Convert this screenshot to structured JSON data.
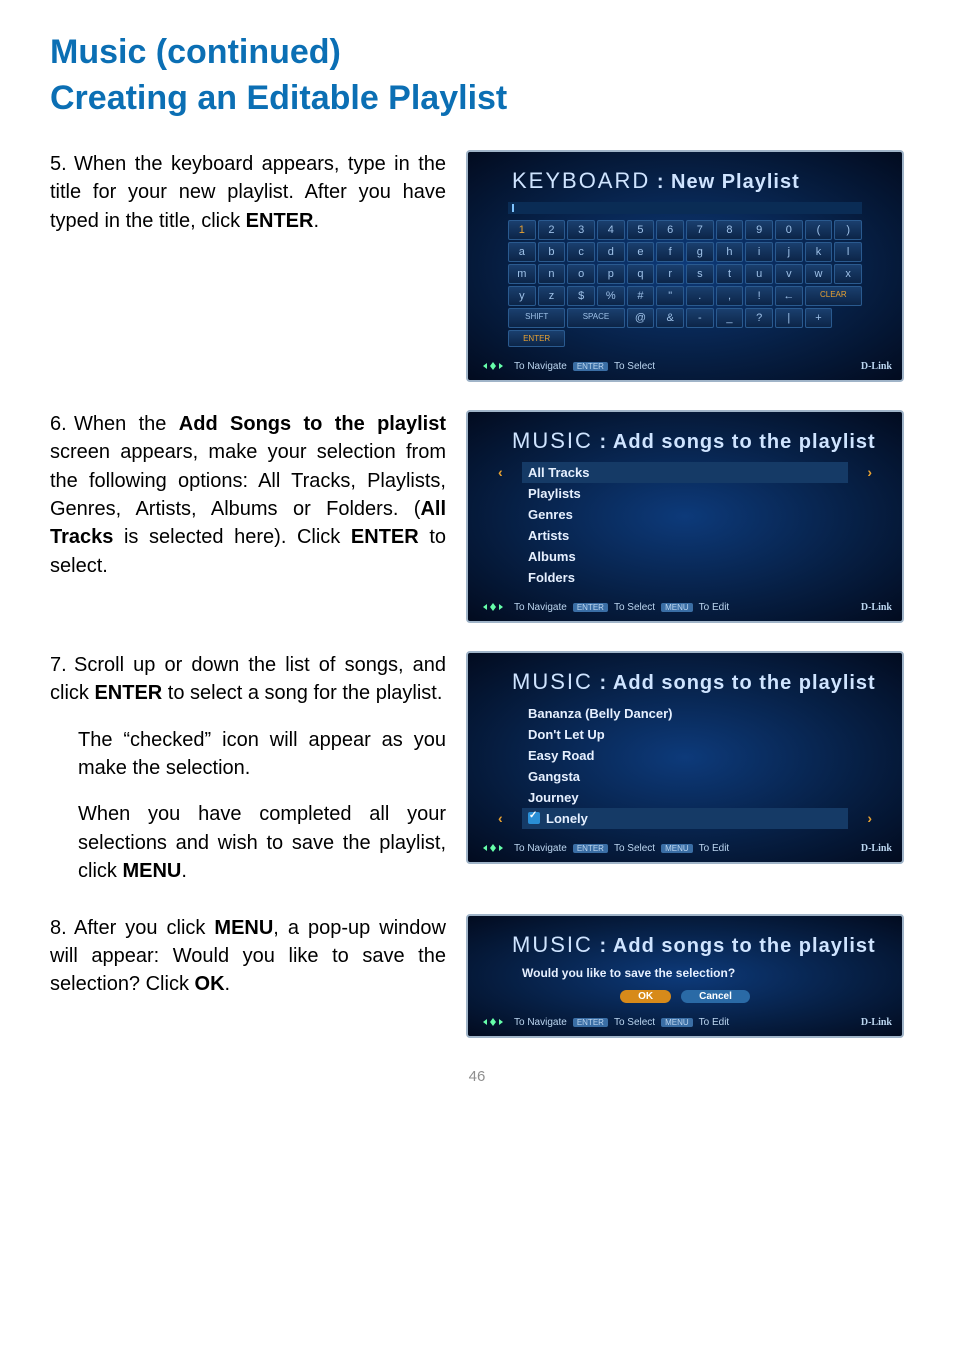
{
  "headings": {
    "line1": "Music (continued)",
    "line2": "Creating an Editable Playlist"
  },
  "steps": {
    "s5": {
      "num": "5.",
      "text_before_enter": "When the keyboard appears, type in the title for your new playlist. After you have typed in the title, click ",
      "enter": "ENTER",
      "text_after_enter": "."
    },
    "s6": {
      "num": "6.",
      "prefix": "When the ",
      "bold1": "Add Songs to the playlist",
      "mid": " screen appears, make your selection from the following options: All Tracks, Playlists, Genres, Artists, Albums or Folders. (",
      "bold2": "All Tracks",
      "after_bold2": " is selected here). Click ",
      "enter": "ENTER",
      "tail": " to select."
    },
    "s7": {
      "num": "7.",
      "p1a": "Scroll up or down the list of songs, and click ",
      "enter": "ENTER",
      "p1b": " to select a song for the playlist.",
      "p2": "The “checked” icon will appear as you make the selection.",
      "p3a": "When you have completed all your selections and wish to save the playlist, click ",
      "menu": "MENU",
      "p3b": "."
    },
    "s8": {
      "num": "8.",
      "a": "After you click ",
      "menu": "MENU",
      "b": ", a pop-up window will appear: Would you like to save the selection? Click ",
      "ok": "OK",
      "c": "."
    }
  },
  "screens": {
    "keyboard": {
      "title_big": "KEYBOARD",
      "title_rest": " : New Playlist",
      "rows": [
        [
          "1",
          "2",
          "3",
          "4",
          "5",
          "6",
          "7",
          "8",
          "9",
          "0",
          "(",
          ")"
        ],
        [
          "a",
          "b",
          "c",
          "d",
          "e",
          "f",
          "g",
          "h",
          "i",
          "j",
          "k",
          "l"
        ],
        [
          "m",
          "n",
          "o",
          "p",
          "q",
          "r",
          "s",
          "t",
          "u",
          "v",
          "w",
          "x"
        ],
        [
          "y",
          "z",
          "$",
          "%",
          "#",
          "\"",
          ".",
          ",",
          "!",
          "←",
          "CLEAR"
        ],
        [
          "SHIFT",
          "SPACE",
          "@",
          "&",
          "-",
          "_",
          "?",
          "|",
          "+",
          "ENTER"
        ]
      ],
      "hints": {
        "nav": "To Navigate",
        "sel": "To Select",
        "brand": "D-Link"
      }
    },
    "addsongs_categories": {
      "title_big": "MUSIC",
      "title_rest": " : Add songs to the playlist",
      "items": [
        "All Tracks",
        "Playlists",
        "Genres",
        "Artists",
        "Albums",
        "Folders"
      ],
      "selected_index": 0,
      "hints": {
        "nav": "To Navigate",
        "sel": "To Select",
        "edit": "To Edit",
        "brand": "D-Link"
      }
    },
    "addsongs_tracks": {
      "title_big": "MUSIC",
      "title_rest": " : Add songs to the playlist",
      "items": [
        "Bananza (Belly Dancer)",
        "Don't Let Up",
        "Easy Road",
        "Gangsta",
        "Journey",
        "Lonely"
      ],
      "selected_index": 5,
      "checked_index": 5,
      "hints": {
        "nav": "To Navigate",
        "sel": "To Select",
        "edit": "To Edit",
        "brand": "D-Link"
      }
    },
    "save_dialog": {
      "title_big": "MUSIC",
      "title_rest": " : Add songs to the playlist",
      "prompt": "Would you like to save the selection?",
      "ok": "OK",
      "cancel": "Cancel",
      "hints": {
        "nav": "To Navigate",
        "sel": "To Select",
        "edit": "To Edit",
        "brand": "D-Link"
      }
    }
  },
  "page_number": "46"
}
